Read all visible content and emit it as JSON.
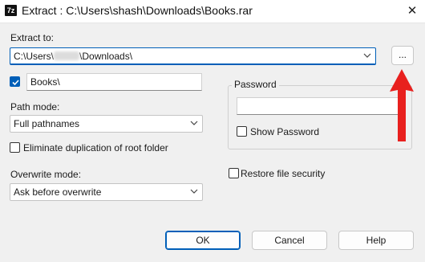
{
  "window": {
    "app_icon_text": "7z",
    "title": "Extract : C:\\Users\\shash\\Downloads\\Books.rar",
    "close_glyph": "✕"
  },
  "extract_to": {
    "label": "Extract to:",
    "path_prefix": "C:\\Users\\",
    "path_suffix": "\\Downloads\\",
    "browse_label": "..."
  },
  "subfolder": {
    "checked": true,
    "value": "Books\\"
  },
  "path_mode": {
    "label": "Path mode:",
    "selected": "Full pathnames"
  },
  "eliminate_duplication": {
    "label": "Eliminate duplication of root folder",
    "checked": false
  },
  "overwrite_mode": {
    "label": "Overwrite mode:",
    "selected": "Ask before overwrite"
  },
  "password": {
    "group_label": "Password",
    "value": "",
    "show_password_label": "Show Password",
    "show_password_checked": false
  },
  "restore_security": {
    "label": "Restore file security",
    "checked": false
  },
  "buttons": {
    "ok": "OK",
    "cancel": "Cancel",
    "help": "Help"
  },
  "colors": {
    "accent": "#005fb8",
    "annotation_arrow": "#e8201e"
  },
  "icons": [
    "app-icon",
    "close-icon",
    "chevron-down-icon",
    "checkmark-icon",
    "annotation-arrow"
  ]
}
